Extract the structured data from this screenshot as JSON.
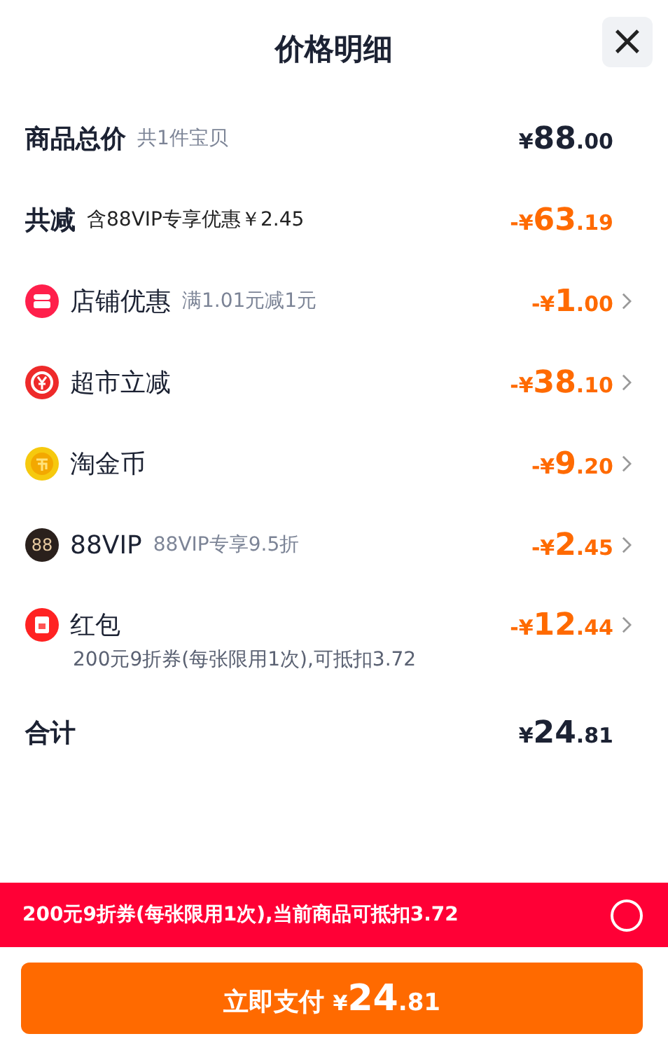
{
  "header": {
    "title": "价格明细",
    "close": "×"
  },
  "rows": [
    {
      "kind": "total",
      "label": "商品总价",
      "note": "共1件宝贝",
      "amount": {
        "symbol": "¥",
        "whole": "88",
        "fraction": ".00"
      }
    },
    {
      "kind": "reduction",
      "label": "共减",
      "note": "含88VIP专享优惠￥2.45",
      "amount": {
        "symbol": "-¥",
        "whole": "63",
        "fraction": ".19"
      }
    },
    {
      "kind": "discount",
      "label": "店铺优惠",
      "note": "满1.01元减1元",
      "amount": {
        "symbol": "-¥",
        "whole": "1",
        "fraction": ".00"
      }
    },
    {
      "kind": "discount",
      "label": "超市立减",
      "amount": {
        "symbol": "-¥",
        "whole": "38",
        "fraction": ".10"
      }
    },
    {
      "kind": "discount",
      "label": "淘金币",
      "amount": {
        "symbol": "-¥",
        "whole": "9",
        "fraction": ".20"
      }
    },
    {
      "kind": "discount",
      "icon_text": "88",
      "label": "88VIP",
      "note": "88VIP专享9.5折",
      "amount": {
        "symbol": "-¥",
        "whole": "2",
        "fraction": ".45"
      }
    },
    {
      "kind": "discount",
      "label": "红包",
      "detail": "200元9折券(每张限用1次),可抵扣3.72",
      "amount": {
        "symbol": "-¥",
        "whole": "12",
        "fraction": ".44"
      }
    },
    {
      "kind": "total",
      "label": "合计",
      "amount": {
        "symbol": "¥",
        "whole": "24",
        "fraction": ".81"
      }
    }
  ],
  "coupon_bar": {
    "text": "200元9折券(每张限用1次),当前商品可抵扣3.72",
    "checked": false
  },
  "pay_button": {
    "label": "立即支付",
    "amount": {
      "symbol": "¥",
      "whole": "24",
      "fraction": ".81"
    }
  }
}
